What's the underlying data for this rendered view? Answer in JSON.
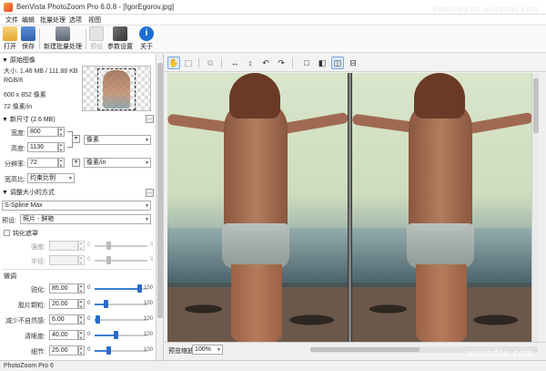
{
  "window": {
    "title": "BenVista PhotoZoom Pro 6.0.8 - [IgorEgorov.jpg]",
    "watermark": "Powered by wusedao.com"
  },
  "menu": [
    "文件",
    "编辑",
    "批量处理",
    "选项",
    "视图"
  ],
  "toolbar": {
    "open": "打开",
    "save": "保存",
    "batch": "新建批量处理",
    "preset": "预设",
    "params": "参数设置",
    "about": "关于"
  },
  "source": {
    "header": "原始图像",
    "size": "大小: 1.46 MB / 111.88 KB",
    "mode": "RGB/8",
    "dims": "600 x 852 像素",
    "res": "72 像素/in"
  },
  "newsize": {
    "header": "新尺寸 (2.6 MB)",
    "width_label": "宽度:",
    "width_value": "800",
    "height_label": "高度:",
    "height_value": "1136",
    "res_label": "分辨率:",
    "res_value": "72",
    "unit_px": "像素",
    "unit_res": "像素/in",
    "ratio_label": "宽高比:",
    "ratio_value": "约束比例"
  },
  "method": {
    "header": "调整大小的方式",
    "algorithm": "S-Spline Max",
    "preset_label": "预设:",
    "preset_value": "照片 - 鲜艳"
  },
  "unsharp": {
    "label": "钝化遮罩",
    "strength_label": "强度:",
    "strength_min": "0",
    "strength_max": "5",
    "radius_label": "半径:",
    "radius_min": "0",
    "radius_max": "5"
  },
  "fine": {
    "header": "微调",
    "rows": [
      {
        "label": "锐化:",
        "value": "85.00",
        "min": "0",
        "max": "100",
        "level": 0.85
      },
      {
        "label": "胶片颗粒:",
        "value": "20.00",
        "min": "0",
        "max": "100",
        "level": 0.2
      },
      {
        "label": "减少不自然感:",
        "value": "6.00",
        "min": "0",
        "max": "100",
        "level": 0.06
      },
      {
        "label": "清晰度:",
        "value": "40.00",
        "min": "0",
        "max": "100",
        "level": 0.4
      },
      {
        "label": "细节:",
        "value": "25.00",
        "min": "0",
        "max": "100",
        "level": 0.25
      }
    ]
  },
  "preview": {
    "label": "预览缩放:",
    "zoom": "100%"
  },
  "status": {
    "text": "PhotoZoom Pro 6"
  },
  "watermark_bottom": "wusedao.com"
}
